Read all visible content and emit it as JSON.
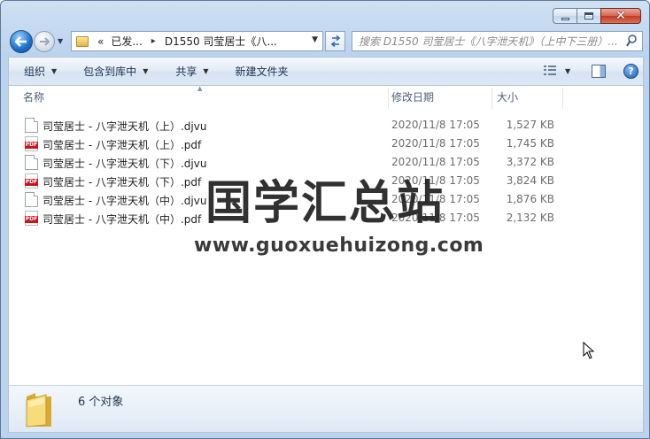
{
  "window": {
    "caption": {
      "minimize_icon": "minimize-icon",
      "maximize_icon": "maximize-icon",
      "close_glyph": "✕"
    }
  },
  "nav": {
    "address_segments": [
      "«",
      "已发...",
      "D1550 司莹居士《八..."
    ],
    "address_separator": "▸",
    "search_placeholder": "搜索 D1550 司莹居士《八字泄天机》（上中下三册）..."
  },
  "toolbar": {
    "items": [
      {
        "label": "组织",
        "has_dropdown": true
      },
      {
        "label": "包含到库中",
        "has_dropdown": true
      },
      {
        "label": "共享",
        "has_dropdown": true
      },
      {
        "label": "新建文件夹",
        "has_dropdown": false
      }
    ],
    "help_label": "?"
  },
  "columns": {
    "name": "名称",
    "modified": "修改日期",
    "size": "大小"
  },
  "files": [
    {
      "name": "司莹居士 - 八字泄天机（上）.djvu",
      "modified": "2020/11/8 17:05",
      "size": "1,527 KB",
      "icon": "djvu-file-icon"
    },
    {
      "name": "司莹居士 - 八字泄天机（上）.pdf",
      "modified": "2020/11/8 17:05",
      "size": "1,745 KB",
      "icon": "pdf-file-icon"
    },
    {
      "name": "司莹居士 - 八字泄天机（下）.djvu",
      "modified": "2020/11/8 17:05",
      "size": "3,372 KB",
      "icon": "djvu-file-icon"
    },
    {
      "name": "司莹居士 - 八字泄天机（下）.pdf",
      "modified": "2020/11/8 17:05",
      "size": "3,824 KB",
      "icon": "pdf-file-icon"
    },
    {
      "name": "司莹居士 - 八字泄天机（中）.djvu",
      "modified": "2020/11/8 17:05",
      "size": "1,876 KB",
      "icon": "djvu-file-icon"
    },
    {
      "name": "司莹居士 - 八字泄天机（中）.pdf",
      "modified": "2020/11/8 17:05",
      "size": "2,132 KB",
      "icon": "pdf-file-icon"
    }
  ],
  "watermark": {
    "logo": "国学汇总站",
    "url": "www.guoxuehuizong.com"
  },
  "status": {
    "count_text": "6 个对象"
  },
  "colors": {
    "frame": "#bcd3ee",
    "pdf_badge": "#c4161c",
    "header_text": "#4c607a"
  }
}
